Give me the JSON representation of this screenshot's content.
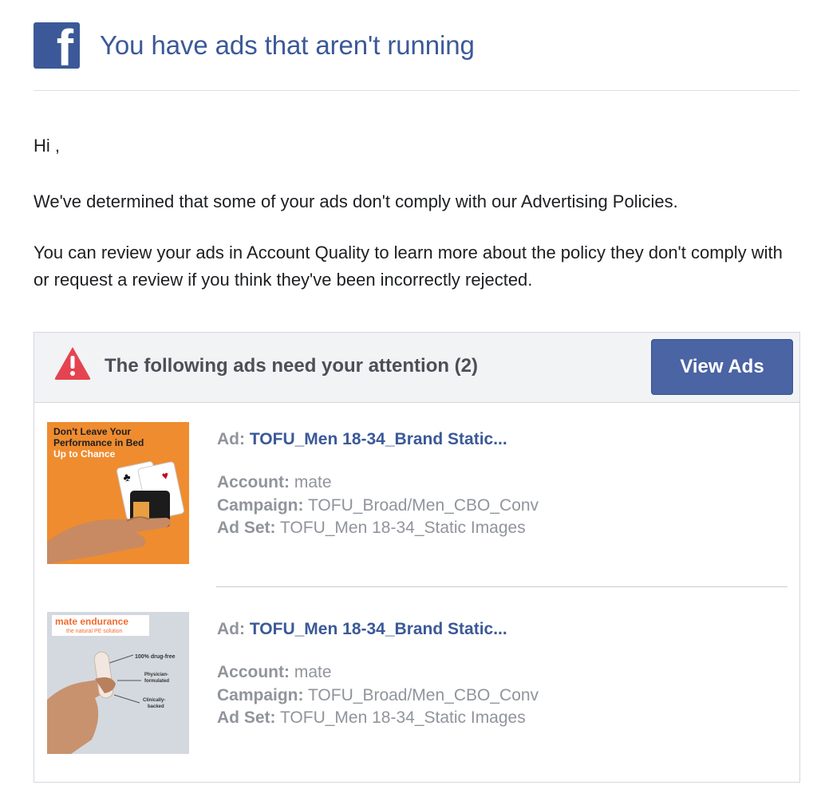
{
  "header": {
    "logo_letter": "f",
    "title": "You have ads that aren't running"
  },
  "body": {
    "greeting": "Hi ,",
    "paragraph1": "We've determined that some of your ads don't comply with our Advertising Policies.",
    "paragraph2": "You can review your ads in Account Quality to learn more about the policy they don't comply with or request a review if you think they've been incorrectly rejected."
  },
  "attention": {
    "title": "The following ads need your attention (2)",
    "button_label": "View Ads"
  },
  "labels": {
    "ad": "Ad:",
    "account": "Account:",
    "campaign": "Campaign:",
    "ad_set": "Ad Set:"
  },
  "ads": [
    {
      "name": "TOFU_Men 18-34_Brand Static...",
      "account": "mate",
      "campaign": "TOFU_Broad/Men_CBO_Conv",
      "ad_set": "TOFU_Men 18-34_Static Images",
      "image_text": [
        "Don't Leave Your",
        "Performance in Bed",
        "Up to Chance"
      ]
    },
    {
      "name": "TOFU_Men 18-34_Brand Static...",
      "account": "mate",
      "campaign": "TOFU_Broad/Men_CBO_Conv",
      "ad_set": "TOFU_Men 18-34_Static Images",
      "image_text": [
        "mate endurance",
        "the natural PE solution",
        "100% drug-free",
        "Physician-",
        "formulated",
        "Clinically-",
        "backed"
      ]
    }
  ],
  "colors": {
    "brand": "#3b5998",
    "button": "#4a64a4",
    "warning": "#e5434f",
    "orange": "#ef8c2f"
  }
}
